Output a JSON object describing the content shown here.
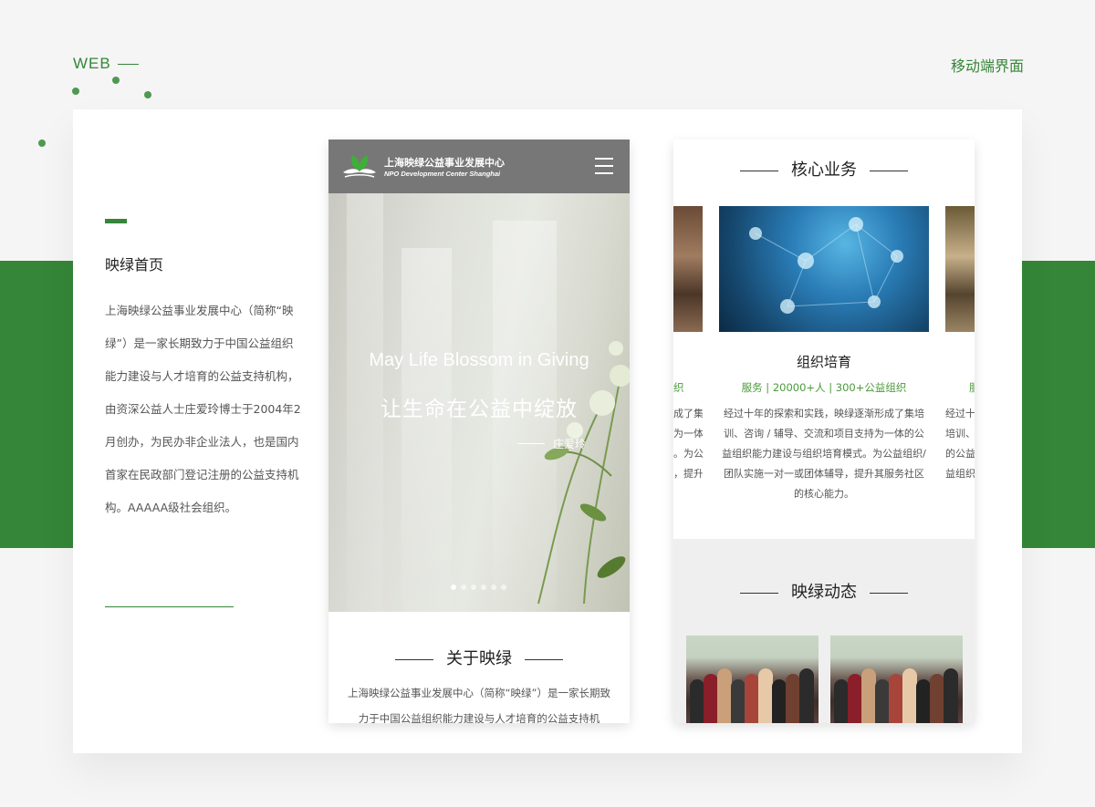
{
  "header": {
    "web_label": "WEB",
    "mobile_label": "移动端界面"
  },
  "intro": {
    "title": "映绿首页",
    "description": "上海映绿公益事业发展中心（简称“映绿”）是一家长期致力于中国公益组织能力建设与人才培育的公益支持机构，由资深公益人士庄爱玲博士于2004年2月创办，为民办非企业法人，也是国内首家在民政部门登记注册的公益支持机构。AAAAA级社会组织。"
  },
  "phone_home": {
    "logo_cn": "上海映绿公益事业发展中心",
    "logo_en": "NPO Development Center Shanghai",
    "hero_en": "May Life Blossom in Giving",
    "hero_cn": "让生命在公益中绽放",
    "hero_author": "庄爱玲",
    "carousel_count": 6,
    "carousel_active": 0,
    "about_title": "关于映绿",
    "about_text": "上海映绿公益事业发展中心（简称“映绿”）是一家长期致力于中国公益组织能力建设与人才培育的公益支持机"
  },
  "phone_core": {
    "core_title": "核心业务",
    "card_title": "组织培育",
    "card_sub": "服务 | 20000+人 | 300+公益组织",
    "card_text": "经过十年的探索和实践，映绿逐渐形成了集培训、咨询 / 辅导、交流和项目支持为一体的公益组织能力建设与组织培育模式。为公益组织/团队实施一对一或团体辅导，提升其服务社区的核心能力。",
    "side_left_sub": "织",
    "side_left_text": [
      "成了集",
      "为一体",
      "。为公",
      "，提升"
    ],
    "side_right_sub": "服",
    "side_right_text": [
      "经过十",
      "培训、",
      "的公益",
      "益组织"
    ],
    "news_title": "映绿动态"
  },
  "colors": {
    "brand_green": "#358638",
    "accent_green": "#4a9a3a"
  }
}
